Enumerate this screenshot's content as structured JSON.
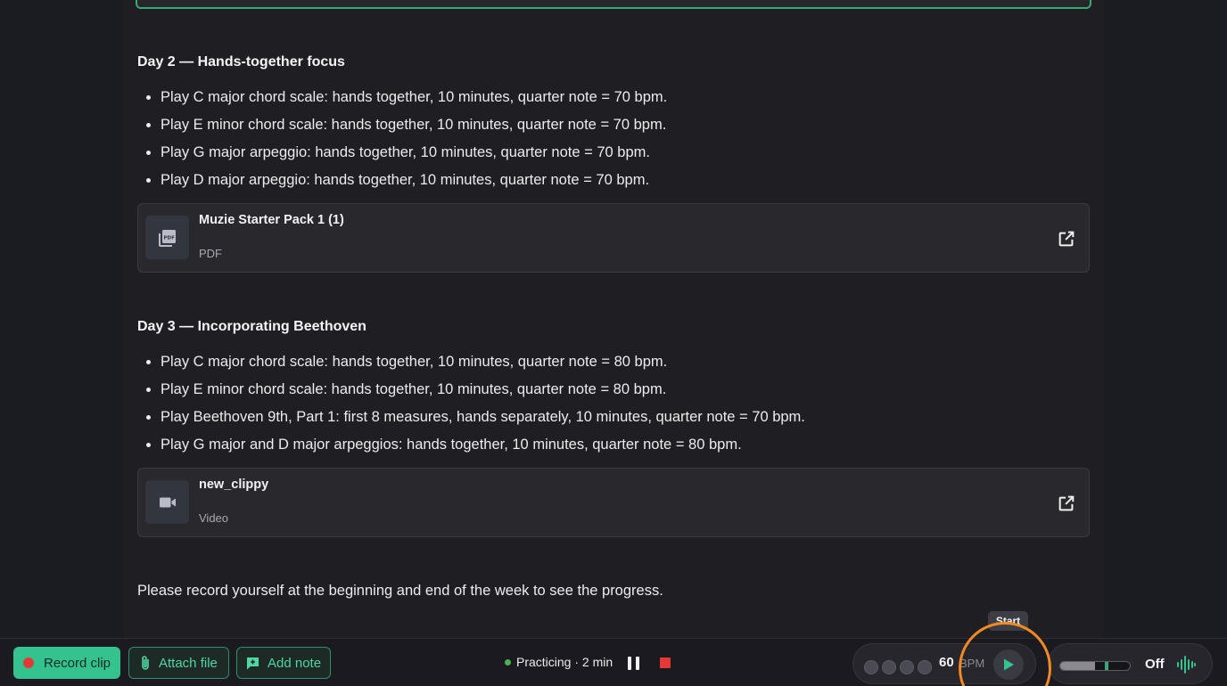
{
  "days": [
    {
      "title": "Day 2 — Hands-together focus",
      "items": [
        "Play C major chord scale: hands together, 10 minutes, quarter note = 70 bpm.",
        "Play E minor chord scale: hands together, 10 minutes, quarter note = 70 bpm.",
        "Play G major arpeggio: hands together, 10 minutes, quarter note = 70 bpm.",
        "Play D major arpeggio: hands together, 10 minutes, quarter note = 70 bpm."
      ],
      "resource": {
        "title": "Muzie Starter Pack 1 (1)",
        "type": "PDF",
        "icon": "pdf-icon"
      }
    },
    {
      "title": "Day 3 — Incorporating Beethoven",
      "items": [
        "Play C major chord scale: hands together, 10 minutes, quarter note = 80 bpm.",
        "Play E minor chord scale: hands together, 10 minutes, quarter note = 80 bpm.",
        "Play Beethoven 9th, Part 1: first 8 measures, hands separately, 10 minutes, quarter note = 70 bpm.",
        "Play G major and D major arpeggios: hands together, 10 minutes, quarter note = 80 bpm."
      ],
      "resource": {
        "title": "new_clippy",
        "type": "Video",
        "icon": "video-camera-icon"
      }
    }
  ],
  "closing_note": "Please record yourself at the beginning and end of the week to see the progress.",
  "bottombar": {
    "record_label": "Record clip",
    "attach_label": "Attach file",
    "note_label": "Add note",
    "status_text": "Practicing · 2 min",
    "metronome": {
      "bpm": "60",
      "unit": "BPM",
      "beats": 4,
      "tooltip": "Start"
    },
    "drone": {
      "label": "Off",
      "level": 0.5
    }
  },
  "colors": {
    "accent": "#34c38f",
    "record": "#e53935",
    "highlight": "#f08a24"
  }
}
